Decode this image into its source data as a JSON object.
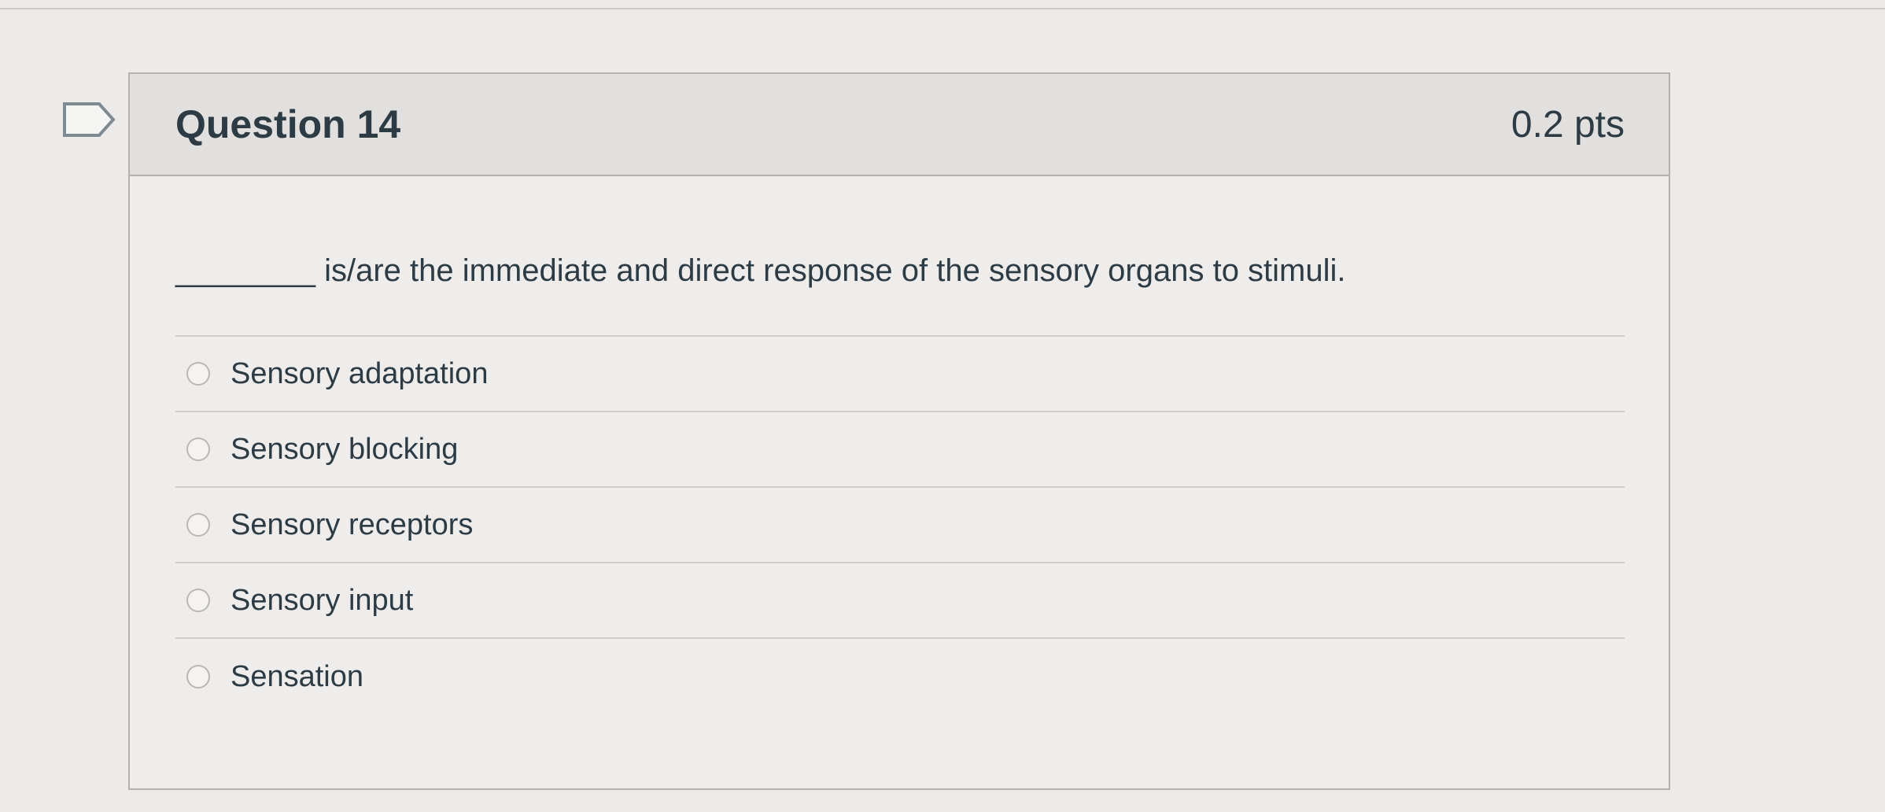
{
  "question": {
    "title": "Question 14",
    "points": "0.2 pts",
    "text": "________ is/are the immediate and direct response of the sensory organs to stimuli."
  },
  "icons": {
    "flag": "flag-question-icon",
    "radio": "radio-button-icon"
  },
  "answers": [
    {
      "label": "Sensory adaptation"
    },
    {
      "label": "Sensory blocking"
    },
    {
      "label": "Sensory receptors"
    },
    {
      "label": "Sensory input"
    },
    {
      "label": "Sensation"
    }
  ]
}
